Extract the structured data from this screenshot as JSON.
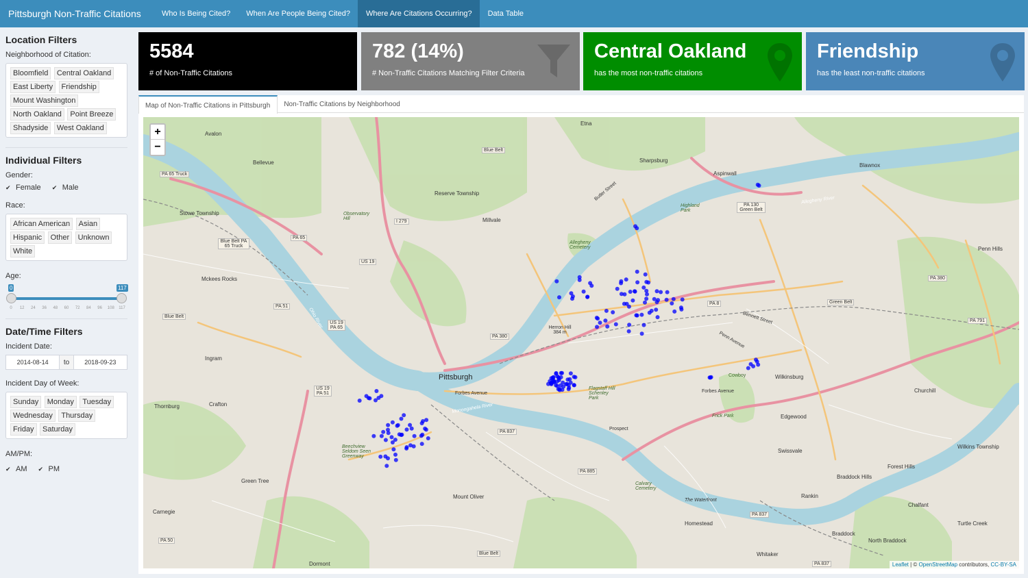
{
  "navbar": {
    "brand": "Pittsburgh Non-Traffic Citations",
    "tabs": [
      {
        "label": "Who Is Being Cited?"
      },
      {
        "label": "When Are People Being Cited?"
      },
      {
        "label": "Where Are Citations Occurring?"
      },
      {
        "label": "Data Table"
      }
    ],
    "active_tab": 2
  },
  "sidebar": {
    "location_title": "Location Filters",
    "neighborhood_label": "Neighborhood of Citation:",
    "neighborhoods": [
      "Bloomfield",
      "Central Oakland",
      "East Liberty",
      "Friendship",
      "Mount Washington",
      "North Oakland",
      "Point Breeze",
      "Shadyside",
      "West Oakland"
    ],
    "individual_title": "Individual Filters",
    "gender_label": "Gender:",
    "gender": [
      "Female",
      "Male"
    ],
    "race_label": "Race:",
    "race": [
      "African American",
      "Asian",
      "Hispanic",
      "Other",
      "Unknown",
      "White"
    ],
    "age_label": "Age:",
    "age_min": "0",
    "age_max": "117",
    "age_range": [
      0,
      117
    ],
    "age_ticks": [
      "0",
      "12",
      "24",
      "36",
      "48",
      "60",
      "72",
      "84",
      "96",
      "108",
      "117"
    ],
    "datetime_title": "Date/Time Filters",
    "date_label": "Incident Date:",
    "date_from": "2014-08-14",
    "date_to_label": "to",
    "date_to": "2018-09-23",
    "dow_label": "Incident Day of Week:",
    "days": [
      "Sunday",
      "Monday",
      "Tuesday",
      "Wednesday",
      "Thursday",
      "Friday",
      "Saturday"
    ],
    "ampm_label": "AM/PM:",
    "ampm": [
      "AM",
      "PM"
    ]
  },
  "value_boxes": [
    {
      "value": "5584",
      "caption": "# of Non-Traffic Citations",
      "color": "#000000"
    },
    {
      "value": "782 (14%)",
      "caption": "# Non-Traffic Citations Matching Filter Criteria",
      "color": "#808080",
      "icon": "filter-icon"
    },
    {
      "value": "Central Oakland",
      "caption": "has the most non-traffic citations",
      "color": "#008d00",
      "icon": "map-marker-icon"
    },
    {
      "value": "Friendship",
      "caption": "has the least non-traffic citations",
      "color": "#4a86b8",
      "icon": "map-marker-icon"
    }
  ],
  "panel_tabs": [
    {
      "label": "Map of Non-Traffic Citations in Pittsburgh"
    },
    {
      "label": "Non-Traffic Citations by Neighborhood"
    }
  ],
  "map": {
    "zoom_in": "+",
    "zoom_out": "−",
    "attribution_leaflet": "Leaflet",
    "attribution_sep": " | © ",
    "attribution_osm": "OpenStreetMap",
    "attribution_contrib": " contributors, ",
    "attribution_license": "CC-BY-SA",
    "labels": {
      "pittsburgh": "Pittsburgh",
      "avalon": "Avalon",
      "bellevue": "Bellevue",
      "etna": "Etna",
      "sharpsburg": "Sharpsburg",
      "aspinwall": "Aspinwall",
      "blawnox": "Blawnox",
      "reserve": "Reserve Township",
      "millvale": "Millvale",
      "stowe": "Stowe Township",
      "mckees": "Mckees Rocks",
      "ingram": "Ingram",
      "crafton": "Crafton",
      "thornburg": "Thornburg",
      "greentree": "Green Tree",
      "carnegie": "Carnegie",
      "dormont": "Dormont",
      "mountoliver": "Mount Oliver",
      "wilkinsburg": "Wilkinsburg",
      "edgewood": "Edgewood",
      "swissvale": "Swissvale",
      "churchill": "Churchill",
      "pennhills": "Penn Hills",
      "wilkins": "Wilkins Township",
      "foresthills": "Forest Hills",
      "braddockhills": "Braddock Hills",
      "rankin": "Rankin",
      "chalfant": "Chalfant",
      "homestead": "Homestead",
      "braddock": "Braddock",
      "northbraddock": "North Braddock",
      "turtlecreek": "Turtle Creek",
      "whitaker": "Whitaker",
      "herron": "Herron Hill 384 m",
      "calvary": "Calvary Cemetery",
      "allegheny": "Allegheny Cemetery",
      "beechview": "Beechview Seldom Seen Greenway",
      "highland": "Highland Park",
      "observatory": "Observatory Hill",
      "cowboy": "Cowboy",
      "frick": "Frick Park",
      "waterfront": "The Waterfront",
      "forbes": "Forbes Avenue",
      "forbes2": "Forbes Avenue",
      "flagstaff": "Flagstaff Hill Schenley Park",
      "prospect": "Prospect",
      "penn": "Penn Avenue",
      "bennett": "Bennett Street",
      "butler": "Butler Street",
      "monriver": "Monongahela River",
      "ohioriver": "Ohio River",
      "allegriver": "Allegheny River"
    },
    "shields": {
      "pa65truck": "PA 65 Truck",
      "bluebelt1": "Blue Belt",
      "bluebelt2": "Blue Belt",
      "bluebelt3": "Blue Belt",
      "bluebeltpa65": "Blue Belt PA 65 Truck",
      "pa65": "PA 65",
      "i279": "I 279",
      "us19": "US 19",
      "us19pa65": "US 19 PA 65",
      "pa51": "PA 51",
      "us19pa51": "US 19 PA 51",
      "pa380": "PA 380",
      "pa380b": "PA 380",
      "pa837": "PA 837",
      "pa837b": "PA 837",
      "pa837c": "PA 837",
      "pa885": "PA 885",
      "pa8": "PA 8",
      "pa130": "PA 130 Green Belt",
      "greenbelt": "Green Belt",
      "pa791": "PA 791",
      "pa50": "PA 50"
    },
    "markers_note_count": "782"
  }
}
